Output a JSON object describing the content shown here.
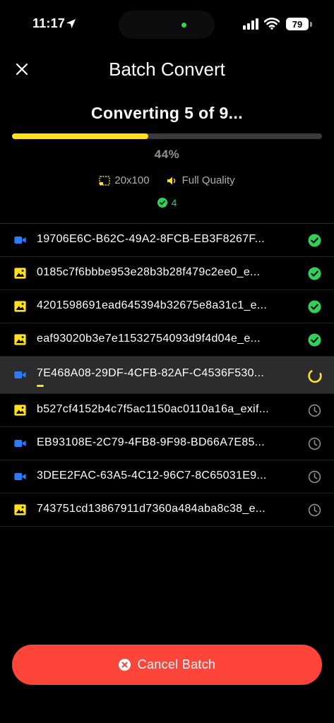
{
  "status_bar": {
    "time": "11:17",
    "battery": "79"
  },
  "nav": {
    "title": "Batch Convert"
  },
  "progress": {
    "title": "Converting 5 of 9...",
    "fraction": 0.44,
    "percent_label": "44%",
    "resolution": "20x100",
    "quality": "Full Quality",
    "completed_count": "4"
  },
  "files": [
    {
      "name": "19706E6C-B62C-49A2-8FCB-EB3F8267F...",
      "kind": "video",
      "status": "done"
    },
    {
      "name": "0185c7f6bbbe953e28b3b28f479c2ee0_e...",
      "kind": "image",
      "status": "done"
    },
    {
      "name": "4201598691ead645394b32675e8a31c1_e...",
      "kind": "image",
      "status": "done"
    },
    {
      "name": "eaf93020b3e7e11532754093d9f4d04e_e...",
      "kind": "image",
      "status": "done"
    },
    {
      "name": "7E468A08-29DF-4CFB-82AF-C4536F530...",
      "kind": "video",
      "status": "converting",
      "fraction": 0.03
    },
    {
      "name": "b527cf4152b4c7f5ac1150ac0110a16a_exif...",
      "kind": "image",
      "status": "pending"
    },
    {
      "name": "EB93108E-2C79-4FB8-9F98-BD66A7E85...",
      "kind": "video",
      "status": "pending"
    },
    {
      "name": "3DEE2FAC-63A5-4C12-96C7-8C65031E9...",
      "kind": "video",
      "status": "pending"
    },
    {
      "name": "743751cd13867911d7360a484aba8c38_e...",
      "kind": "image",
      "status": "pending"
    }
  ],
  "cancel_button": {
    "label": "Cancel Batch"
  },
  "colors": {
    "accent_yellow": "#ffe01b",
    "success_green": "#30d158",
    "video_blue": "#2f7bf5",
    "cancel_red": "#ff453a",
    "pending_gray": "#8e8e93"
  }
}
